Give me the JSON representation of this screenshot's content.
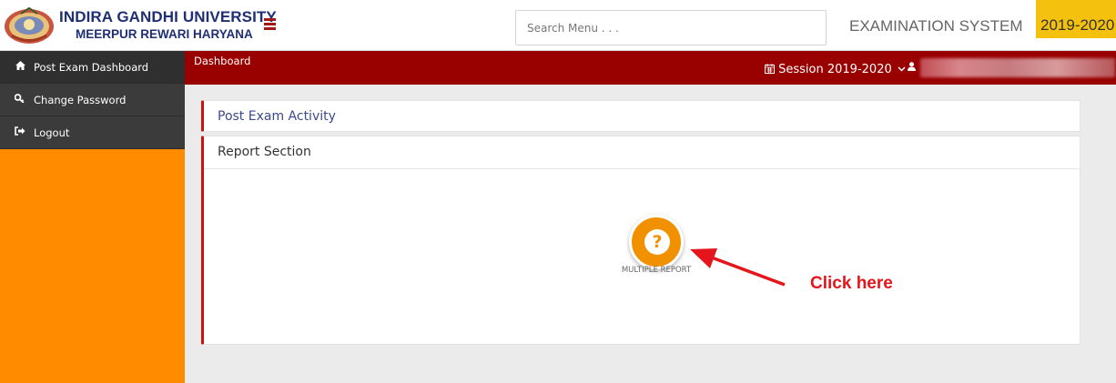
{
  "header": {
    "university_line1": "INDIRA GANDHI UNIVERSITY",
    "university_line2": "MEERPUR REWARI HARYANA",
    "search_placeholder": "Search Menu . . .",
    "system_title": "EXAMINATION SYSTEM",
    "year_badge": "2019-2020"
  },
  "sidebar": {
    "items": [
      {
        "icon": "home-icon",
        "label": "Post Exam Dashboard"
      },
      {
        "icon": "key-icon",
        "label": "Change Password"
      },
      {
        "icon": "sign-out-icon",
        "label": "Logout"
      }
    ]
  },
  "topnav": {
    "breadcrumb": "Dashboard",
    "session_label": "Session  2019-2020"
  },
  "panels": {
    "post_exam_activity": "Post Exam Activity",
    "report_section": "Report Section"
  },
  "report": {
    "button_icon": "?",
    "label": "MULTIPLE REPORT"
  },
  "annotation": {
    "text": "Click here",
    "color": "#e5161b"
  },
  "colors": {
    "sidebar_bg": "#ff8c00",
    "menu_bg": "#3b3b3b",
    "header_bar": "#990000",
    "accent_orange": "#f29100",
    "year_badge": "#f4c10f"
  }
}
